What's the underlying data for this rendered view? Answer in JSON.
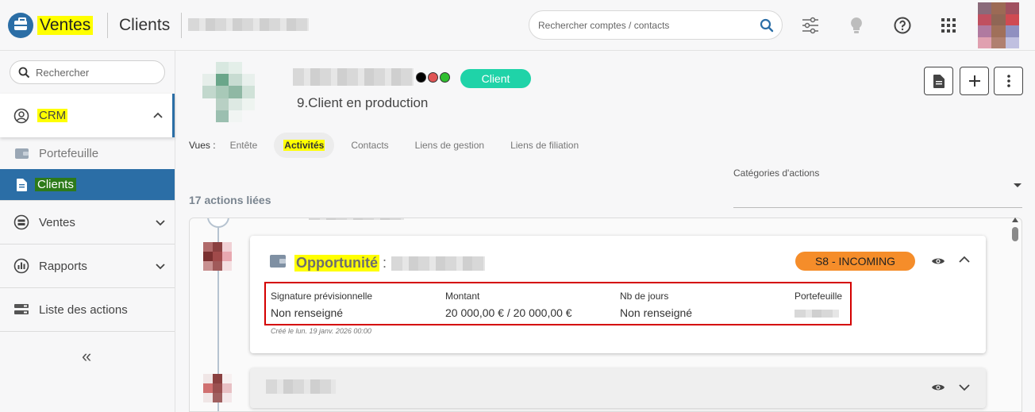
{
  "topbar": {
    "app_title": "Ventes",
    "module_title": "Clients",
    "search_placeholder": "Rechercher comptes / contacts"
  },
  "sidebar": {
    "search_placeholder": "Rechercher",
    "items": [
      {
        "label": "CRM",
        "icon": "crm-icon",
        "expanded": true
      },
      {
        "label": "Portefeuille",
        "icon": "wallet-icon"
      },
      {
        "label": "Clients",
        "icon": "document-icon",
        "active": true
      },
      {
        "label": "Ventes",
        "icon": "register-icon"
      },
      {
        "label": "Rapports",
        "icon": "chart-icon"
      },
      {
        "label": "Liste des actions",
        "icon": "list-icon"
      }
    ],
    "collapse_glyph": "«"
  },
  "client": {
    "badge": "Client",
    "status": "9.Client en production",
    "dot_colors": [
      "#000000",
      "#e05555",
      "#2fbf2f"
    ]
  },
  "views": {
    "label": "Vues :",
    "tabs": [
      "Entête",
      "Activités",
      "Contacts",
      "Liens de gestion",
      "Liens de filiation"
    ],
    "active": "Activités"
  },
  "categories": {
    "label": "Catégories d'actions"
  },
  "actions_count": "17 actions liées",
  "activity": {
    "type_label": "Opportunité",
    "separator": ":",
    "stage": "S8 - INCOMING",
    "fields": [
      {
        "key": "Signature prévisionnelle",
        "value": "Non renseigné"
      },
      {
        "key": "Montant",
        "value": "20 000,00 € / 20 000,00 €"
      },
      {
        "key": "Nb de jours",
        "value": "Non renseigné"
      },
      {
        "key": "Portefeuille",
        "value": ""
      }
    ],
    "created": "Créé le lun. 19 janv. 2026 00:00"
  },
  "colors": {
    "primary": "#2b6ea6",
    "client_badge": "#1fd3a8",
    "stage_badge": "#f58d2a",
    "highlight": "#ffff00"
  }
}
